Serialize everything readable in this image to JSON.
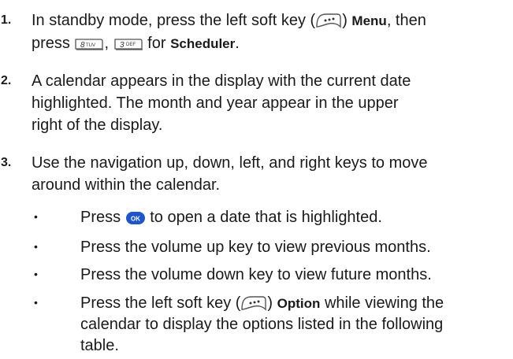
{
  "steps": [
    {
      "number": "1.",
      "pre": "In standby mode, press the left soft key (",
      "close": ")",
      "menu_label": "Menu",
      "then": ", then",
      "press": "press",
      "comma": ",",
      "for": "for",
      "scheduler_label": "Scheduler",
      "period": "."
    },
    {
      "number": "2.",
      "lines": [
        "A calendar appears in the display with the current date",
        "highlighted. The month and year appear in the upper",
        "right of the display."
      ]
    },
    {
      "number": "3.",
      "lines": [
        "Use the navigation up, down, left, and right keys to move",
        "around within the calendar."
      ]
    }
  ],
  "bullets": [
    {
      "symbol": "•",
      "pre": "Press",
      "post": "to open a date that is highlighted."
    },
    {
      "symbol": "•",
      "text": "Press the volume up key to view previous months."
    },
    {
      "symbol": "•",
      "text": "Press the volume down key to view future months."
    },
    {
      "symbol": "•",
      "pre": "Press the left soft key (",
      "close": ")",
      "option_label": "Option",
      "post": " while viewing the",
      "lines": [
        "calendar to display the options listed in the following",
        "table."
      ]
    }
  ],
  "keys": {
    "key8": {
      "digit": "8",
      "letters": "TUV"
    },
    "key3": {
      "digit": "3",
      "letters": "DEF"
    },
    "ok": "OK"
  },
  "colors": {
    "text": "#1a1a1a",
    "ok_key": "#1e55c8",
    "key_outline": "#555555"
  },
  "icons": [
    "soft-key-icon",
    "key-8-icon",
    "key-3-icon",
    "ok-key-icon"
  ]
}
